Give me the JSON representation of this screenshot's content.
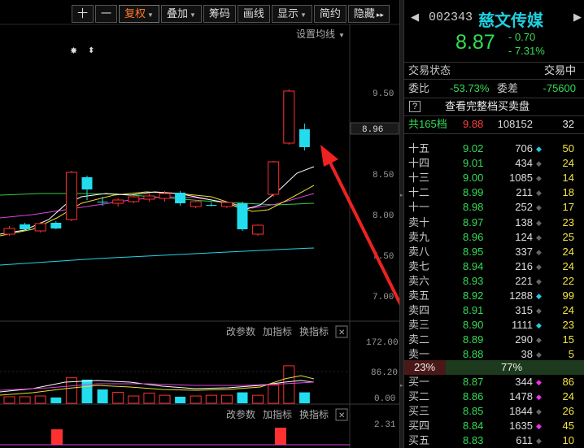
{
  "toolbar": {
    "plus": "十",
    "minus": "一",
    "fuquan": "复权",
    "diejia": "叠加",
    "chouma": "筹码",
    "huaxian": "画线",
    "xianshi": "显示",
    "jianyue": "简约",
    "yincang": "隐藏",
    "collapse": "▸▸"
  },
  "chart": {
    "set_ma": "设置均线",
    "price_labels": [
      "9.50",
      "8.96",
      "8.50",
      "8.00",
      "7.50",
      "7.00"
    ],
    "top_markers": [
      "✸",
      "⬍"
    ],
    "vol_labels": [
      "172.00",
      "86.20",
      "0.00"
    ],
    "macd_labels": [
      "2.31"
    ],
    "panel_actions": {
      "change_params": "改参数",
      "add_indicator": "加指标",
      "swap_indicator": "换指标",
      "close": "✕"
    },
    "candles": [
      {
        "o": 7.8,
        "c": 7.87,
        "h": 7.9,
        "l": 7.78,
        "color": "red"
      },
      {
        "o": 7.92,
        "c": 7.86,
        "h": 7.94,
        "l": 7.84,
        "color": "cyan"
      },
      {
        "o": 7.84,
        "c": 7.93,
        "h": 7.95,
        "l": 7.82,
        "color": "red"
      },
      {
        "o": 7.94,
        "c": 7.87,
        "h": 7.96,
        "l": 7.86,
        "color": "cyan"
      },
      {
        "o": 7.98,
        "c": 8.56,
        "h": 8.58,
        "l": 7.96,
        "color": "red"
      },
      {
        "o": 8.5,
        "c": 8.35,
        "h": 8.52,
        "l": 8.22,
        "color": "cyan"
      },
      {
        "o": 8.2,
        "c": 8.2,
        "h": 8.26,
        "l": 8.15,
        "color": "cyan"
      },
      {
        "o": 8.18,
        "c": 8.22,
        "h": 8.24,
        "l": 8.14,
        "color": "red"
      },
      {
        "o": 8.2,
        "c": 8.26,
        "h": 8.28,
        "l": 8.18,
        "color": "red"
      },
      {
        "o": 8.23,
        "c": 8.27,
        "h": 8.3,
        "l": 8.2,
        "color": "red"
      },
      {
        "o": 8.24,
        "c": 8.3,
        "h": 8.33,
        "l": 8.2,
        "color": "red"
      },
      {
        "o": 8.31,
        "c": 8.18,
        "h": 8.33,
        "l": 8.15,
        "color": "cyan"
      },
      {
        "o": 8.14,
        "c": 8.2,
        "h": 8.22,
        "l": 8.12,
        "color": "red"
      },
      {
        "o": 8.16,
        "c": 8.16,
        "h": 8.19,
        "l": 8.14,
        "color": "cyan"
      },
      {
        "o": 8.14,
        "c": 8.19,
        "h": 8.2,
        "l": 8.12,
        "color": "red"
      },
      {
        "o": 8.18,
        "c": 7.86,
        "h": 8.2,
        "l": 7.84,
        "color": "cyan"
      },
      {
        "o": 7.8,
        "c": 7.91,
        "h": 7.92,
        "l": 7.78,
        "color": "red"
      },
      {
        "o": 8.29,
        "c": 8.69,
        "h": 8.7,
        "l": 8.26,
        "color": "red"
      },
      {
        "o": 8.92,
        "c": 9.56,
        "h": 9.58,
        "l": 8.9,
        "color": "red"
      },
      {
        "o": 9.09,
        "c": 8.87,
        "h": 9.16,
        "l": 8.83,
        "color": "cyan"
      }
    ],
    "volumes": [
      {
        "v": 18,
        "color": "red"
      },
      {
        "v": 18,
        "color": "red"
      },
      {
        "v": 20,
        "color": "red"
      },
      {
        "v": 16,
        "color": "cyan"
      },
      {
        "v": 70,
        "color": "red"
      },
      {
        "v": 65,
        "color": "cyan"
      },
      {
        "v": 38,
        "color": "cyan"
      },
      {
        "v": 30,
        "color": "red"
      },
      {
        "v": 20,
        "color": "red"
      },
      {
        "v": 28,
        "color": "red"
      },
      {
        "v": 22,
        "color": "red"
      },
      {
        "v": 18,
        "color": "cyan"
      },
      {
        "v": 20,
        "color": "red"
      },
      {
        "v": 22,
        "color": "red"
      },
      {
        "v": 22,
        "color": "red"
      },
      {
        "v": 30,
        "color": "cyan"
      },
      {
        "v": 22,
        "color": "red"
      },
      {
        "v": 50,
        "color": "red"
      },
      {
        "v": 103,
        "color": "red"
      },
      {
        "v": 30,
        "color": "cyan"
      }
    ],
    "macd_bars": [
      {
        "v": 1.9,
        "color": "red"
      },
      {
        "v": 2.1,
        "color": "red"
      }
    ]
  },
  "quote": {
    "code": "002343",
    "name": "慈文传媒",
    "price": "8.87",
    "change": "- 0.70",
    "change_pct": "- 7.31%",
    "status_label": "交易状态",
    "status_value": "交易中",
    "weibi_label": "委比",
    "weibi_value": "-53.73%",
    "weicha_label": "委差",
    "weicha_value": "-75600",
    "help_icon": "?",
    "full_book": "查看完整档买卖盘",
    "total_label": "共165档",
    "total_price": "9.88",
    "total_vol": "108152",
    "total_cnt": "32",
    "asks": [
      {
        "label": "十五",
        "price": "9.02",
        "vol": "706",
        "dot": "cyan",
        "cnt": "50"
      },
      {
        "label": "十四",
        "price": "9.01",
        "vol": "434",
        "dot": "gray",
        "cnt": "24"
      },
      {
        "label": "十三",
        "price": "9.00",
        "vol": "1085",
        "dot": "gray",
        "cnt": "14"
      },
      {
        "label": "十二",
        "price": "8.99",
        "vol": "211",
        "dot": "gray",
        "cnt": "18"
      },
      {
        "label": "十一",
        "price": "8.98",
        "vol": "252",
        "dot": "gray",
        "cnt": "17"
      },
      {
        "label": "卖十",
        "price": "8.97",
        "vol": "138",
        "dot": "gray",
        "cnt": "23"
      },
      {
        "label": "卖九",
        "price": "8.96",
        "vol": "124",
        "dot": "gray",
        "cnt": "25"
      },
      {
        "label": "卖八",
        "price": "8.95",
        "vol": "337",
        "dot": "gray",
        "cnt": "24"
      },
      {
        "label": "卖七",
        "price": "8.94",
        "vol": "216",
        "dot": "gray",
        "cnt": "24"
      },
      {
        "label": "卖六",
        "price": "8.93",
        "vol": "221",
        "dot": "gray",
        "cnt": "22"
      },
      {
        "label": "卖五",
        "price": "8.92",
        "vol": "1288",
        "dot": "cyan",
        "cnt": "99"
      },
      {
        "label": "卖四",
        "price": "8.91",
        "vol": "315",
        "dot": "gray",
        "cnt": "24"
      },
      {
        "label": "卖三",
        "price": "8.90",
        "vol": "1111",
        "dot": "cyan",
        "cnt": "23"
      },
      {
        "label": "卖二",
        "price": "8.89",
        "vol": "290",
        "dot": "gray",
        "cnt": "15"
      },
      {
        "label": "卖一",
        "price": "8.88",
        "vol": "38",
        "dot": "gray",
        "cnt": "5"
      }
    ],
    "bar_left": "23%",
    "bar_right": "77%",
    "bar_left_fraction": 0.23,
    "bids": [
      {
        "label": "买一",
        "price": "8.87",
        "vol": "344",
        "dot": "magenta",
        "cnt": "86"
      },
      {
        "label": "买二",
        "price": "8.86",
        "vol": "1478",
        "dot": "magenta",
        "cnt": "24"
      },
      {
        "label": "买三",
        "price": "8.85",
        "vol": "1844",
        "dot": "gray",
        "cnt": "26"
      },
      {
        "label": "买四",
        "price": "8.84",
        "vol": "1635",
        "dot": "magenta",
        "cnt": "45"
      },
      {
        "label": "买五",
        "price": "8.83",
        "vol": "611",
        "dot": "gray",
        "cnt": "10"
      }
    ],
    "nav_prev": "◀",
    "nav_next": "▶"
  },
  "colors": {
    "up": "#ff3030",
    "down": "#22ddee",
    "accent_orange": "#ff7a2a",
    "arrow": "#ee2222"
  }
}
